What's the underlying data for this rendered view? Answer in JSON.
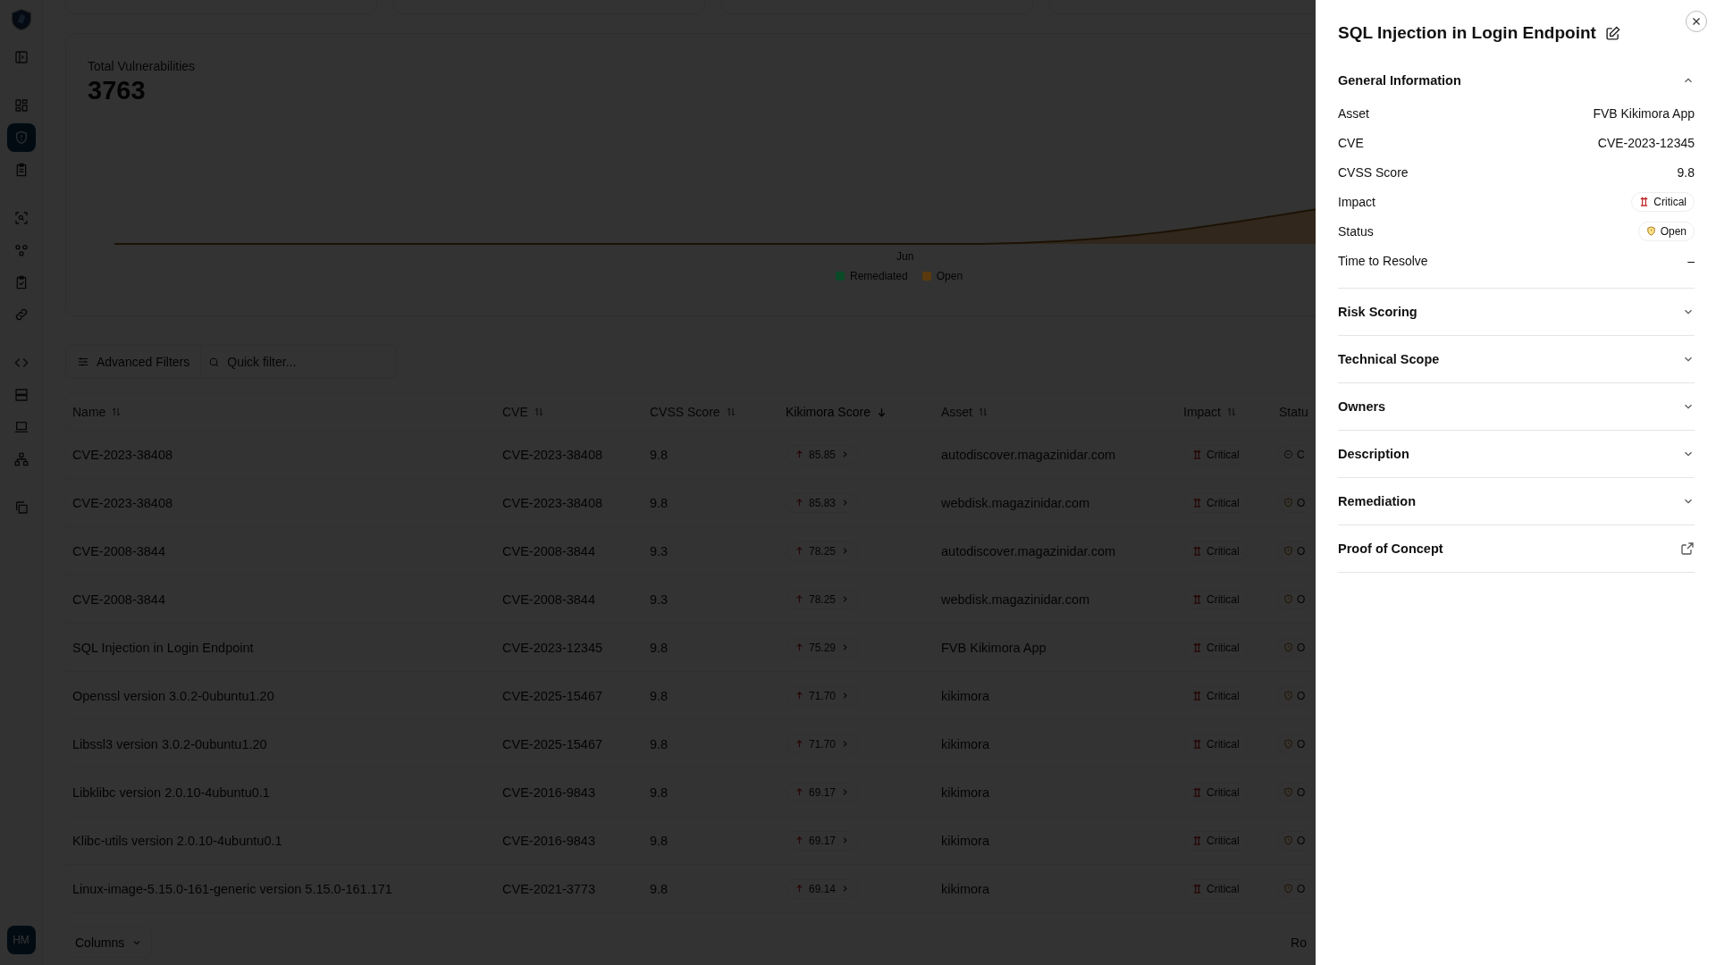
{
  "sidebar": {
    "items": [
      {
        "selected": false
      },
      {
        "selected": false
      },
      {
        "selected": true
      },
      {
        "selected": false
      },
      {
        "selected": false
      },
      {
        "selected": false
      },
      {
        "selected": false
      },
      {
        "selected": false
      },
      {
        "selected": false
      },
      {
        "selected": false
      },
      {
        "selected": false
      },
      {
        "selected": false
      },
      {
        "selected": false
      }
    ],
    "avatar": "HM"
  },
  "summary": {
    "label": "Total Vulnerabilities",
    "value": "3763",
    "x_label": "Jun",
    "legend": [
      {
        "name": "Remediated",
        "color": "#0b4a26"
      },
      {
        "name": "Open",
        "color": "#5a3a0e"
      }
    ]
  },
  "filters": {
    "button": "Advanced Filters",
    "placeholder": "Quick filter..."
  },
  "table": {
    "columns": [
      {
        "label": "Name",
        "sorted": false
      },
      {
        "label": "CVE",
        "sorted": false
      },
      {
        "label": "CVSS Score",
        "sorted": false
      },
      {
        "label": "Kikimora Score",
        "sorted": true
      },
      {
        "label": "Asset",
        "sorted": false
      },
      {
        "label": "Impact",
        "sorted": false
      },
      {
        "label": "Statu",
        "sorted": false
      }
    ],
    "rows": [
      {
        "name": "CVE-2023-38408",
        "cve": "CVE-2023-38408",
        "cvss": "9.8",
        "score": "85.85",
        "asset": "autodiscover.magazinidar.com",
        "impact": "Critical",
        "status": {
          "text": "C",
          "kind": "minus"
        }
      },
      {
        "name": "CVE-2023-38408",
        "cve": "CVE-2023-38408",
        "cvss": "9.8",
        "score": "85.83",
        "asset": "webdisk.magazinidar.com",
        "impact": "Critical",
        "status": {
          "text": "O",
          "kind": "shield"
        }
      },
      {
        "name": "CVE-2008-3844",
        "cve": "CVE-2008-3844",
        "cvss": "9.3",
        "score": "78.25",
        "asset": "autodiscover.magazinidar.com",
        "impact": "Critical",
        "status": {
          "text": "O",
          "kind": "shield"
        }
      },
      {
        "name": "CVE-2008-3844",
        "cve": "CVE-2008-3844",
        "cvss": "9.3",
        "score": "78.25",
        "asset": "webdisk.magazinidar.com",
        "impact": "Critical",
        "status": {
          "text": "O",
          "kind": "shield"
        }
      },
      {
        "name": "SQL Injection in Login Endpoint",
        "cve": "CVE-2023-12345",
        "cvss": "9.8",
        "score": "75.29",
        "asset": "FVB Kikimora App",
        "impact": "Critical",
        "status": {
          "text": "O",
          "kind": "shield"
        }
      },
      {
        "name": "Openssl version 3.0.2-0ubuntu1.20",
        "cve": "CVE-2025-15467",
        "cvss": "9.8",
        "score": "71.70",
        "asset": "kikimora",
        "impact": "Critical",
        "status": {
          "text": "O",
          "kind": "shield"
        }
      },
      {
        "name": "Libssl3 version 3.0.2-0ubuntu1.20",
        "cve": "CVE-2025-15467",
        "cvss": "9.8",
        "score": "71.70",
        "asset": "kikimora",
        "impact": "Critical",
        "status": {
          "text": "O",
          "kind": "shield"
        }
      },
      {
        "name": "Libklibc version 2.0.10-4ubuntu0.1",
        "cve": "CVE-2016-9843",
        "cvss": "9.8",
        "score": "69.17",
        "asset": "kikimora",
        "impact": "Critical",
        "status": {
          "text": "O",
          "kind": "shield"
        }
      },
      {
        "name": "Klibc-utils version 2.0.10-4ubuntu0.1",
        "cve": "CVE-2016-9843",
        "cvss": "9.8",
        "score": "69.17",
        "asset": "kikimora",
        "impact": "Critical",
        "status": {
          "text": "O",
          "kind": "shield"
        }
      },
      {
        "name": "Linux-image-5.15.0-161-generic version 5.15.0-161.171",
        "cve": "CVE-2021-3773",
        "cvss": "9.8",
        "score": "69.14",
        "asset": "kikimora",
        "impact": "Critical",
        "status": {
          "text": "O",
          "kind": "shield"
        }
      }
    ]
  },
  "footer": {
    "columns_button": "Columns",
    "rows_label": "Ro"
  },
  "panel": {
    "title": "SQL Injection in Login Endpoint",
    "sections": [
      {
        "title": "General Information",
        "kind": "accordion",
        "expanded": true,
        "fields": [
          {
            "label": "Asset",
            "value": "FVB Kikimora App",
            "kind": "text"
          },
          {
            "label": "CVE",
            "value": "CVE-2023-12345",
            "kind": "text"
          },
          {
            "label": "CVSS Score",
            "value": "9.8",
            "kind": "text"
          },
          {
            "label": "Impact",
            "value": "Critical",
            "kind": "impact"
          },
          {
            "label": "Status",
            "value": "Open",
            "kind": "status"
          },
          {
            "label": "Time to Resolve",
            "value": "–",
            "kind": "text"
          }
        ]
      },
      {
        "title": "Risk Scoring",
        "kind": "accordion",
        "expanded": false
      },
      {
        "title": "Technical Scope",
        "kind": "accordion",
        "expanded": false
      },
      {
        "title": "Owners",
        "kind": "accordion",
        "expanded": false
      },
      {
        "title": "Description",
        "kind": "accordion",
        "expanded": false
      },
      {
        "title": "Remediation",
        "kind": "accordion",
        "expanded": false
      },
      {
        "title": "Proof of Concept",
        "kind": "link"
      }
    ]
  }
}
